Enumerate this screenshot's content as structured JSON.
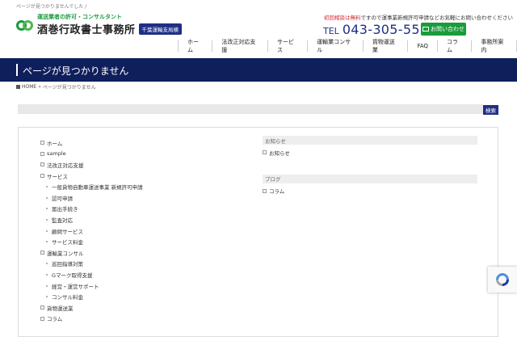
{
  "header": {
    "top_note": "ページが見つかりませんでした /",
    "logo_sub": "運送業者の許可・コンサルタント",
    "logo_name": "酒巻行政書士事務所",
    "logo_badge": "千葉運輸支局横",
    "note_red": "初回相談は無料",
    "note_rest": "ですので運事業新規許可申請などお気軽にお問い合わせください",
    "tel_label": "TEL",
    "tel_number": "043-305-5557",
    "contact_label": "お問い合わせ"
  },
  "nav": [
    "ホーム",
    "法改正対応支援",
    "サービス",
    "運輸業コンサル",
    "貨物運送業",
    "FAQ",
    "コラム",
    "事務所案内"
  ],
  "page_title": "ページが見つかりません",
  "breadcrumb": {
    "home": "HOME",
    "sep": "»",
    "current": "ページが見つかりません"
  },
  "search": {
    "button": "検索"
  },
  "sitemap": {
    "left": [
      {
        "label": "ホーム",
        "level": 0
      },
      {
        "label": "sample",
        "level": 0
      },
      {
        "label": "法改正対応支援",
        "level": 0
      },
      {
        "label": "サービス",
        "level": 0
      },
      {
        "label": "一般貨物自動車運送事業 新規許可申請",
        "level": 1
      },
      {
        "label": "認可申請",
        "level": 1
      },
      {
        "label": "届出手続き",
        "level": 1
      },
      {
        "label": "監査対応",
        "level": 1
      },
      {
        "label": "顧問サービス",
        "level": 1
      },
      {
        "label": "サービス料金",
        "level": 1
      },
      {
        "label": "運輸業コンサル",
        "level": 0
      },
      {
        "label": "巡回指導対策",
        "level": 1
      },
      {
        "label": "Gマーク取得支援",
        "level": 1
      },
      {
        "label": "経営・運営サポート",
        "level": 1
      },
      {
        "label": "コンサル料金",
        "level": 1
      },
      {
        "label": "貨物運送業",
        "level": 0
      },
      {
        "label": "コラム",
        "level": 0
      }
    ],
    "right": [
      {
        "heading": "お知らせ",
        "item": "お知らせ"
      },
      {
        "heading": "ブログ",
        "item": "コラム"
      }
    ]
  },
  "colors": {
    "navy": "#0f1f5c",
    "green": "#1a9b3c",
    "red": "#d7232a"
  }
}
